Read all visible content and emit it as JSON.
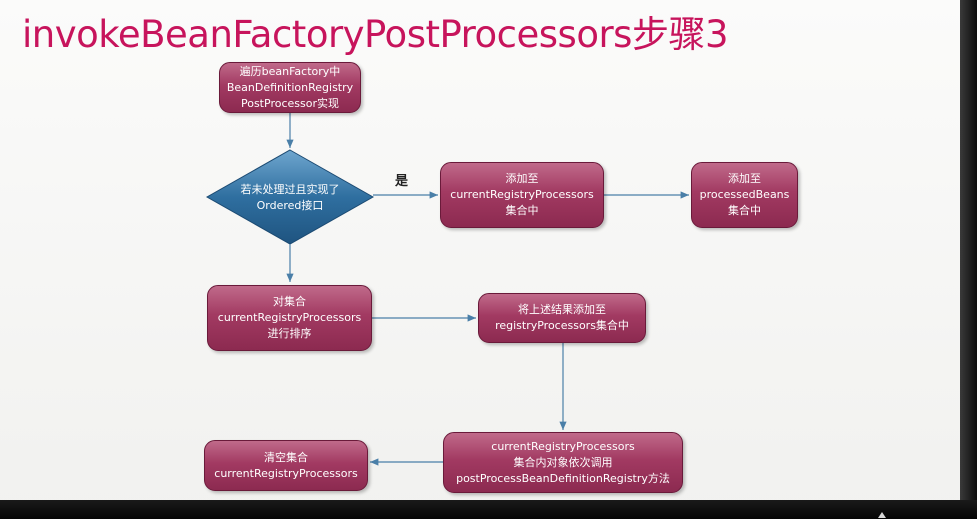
{
  "title": "invokeBeanFactoryPostProcessors步骤3",
  "colors": {
    "title": "#c7145c",
    "box_fill": "#a23a62",
    "diamond_fill": "#2f6fa0",
    "arrow": "#4a7fa8"
  },
  "nodes": {
    "start": "遍历beanFactory中\nBeanDefinitionRegistry\nPostProcessor实现",
    "decision": "若未处理过且实现了\nOrdered接口",
    "add_current": "添加至\ncurrentRegistryProcessors\n集合中",
    "add_processed": "添加至\nprocessedBeans\n集合中",
    "sort": "对集合\ncurrentRegistryProcessors\n进行排序",
    "add_registry": "将上述结果添加至\nregistryProcessors集合中",
    "invoke": "currentRegistryProcessors\n集合内对象依次调用\npostProcessBeanDefinitionRegistry方法",
    "clear": "清空集合\ncurrentRegistryProcessors"
  },
  "edge_labels": {
    "yes": "是"
  }
}
